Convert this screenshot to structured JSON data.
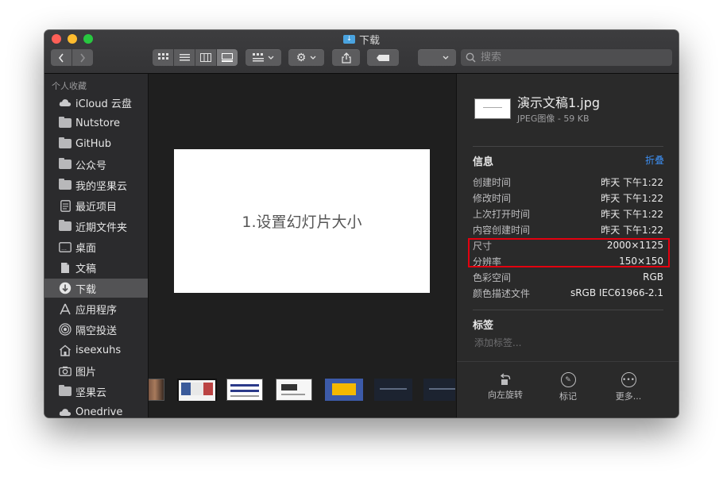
{
  "window": {
    "title": "下载"
  },
  "toolbar": {
    "search_placeholder": "搜索"
  },
  "sidebar": {
    "header": "个人收藏",
    "items": [
      {
        "label": "iCloud 云盘",
        "icon": "cloud-icon"
      },
      {
        "label": "Nutstore",
        "icon": "folder-icon"
      },
      {
        "label": "GitHub",
        "icon": "folder-icon"
      },
      {
        "label": "公众号",
        "icon": "folder-icon"
      },
      {
        "label": "我的坚果云",
        "icon": "folder-icon"
      },
      {
        "label": "最近项目",
        "icon": "recents-icon"
      },
      {
        "label": "近期文件夹",
        "icon": "folder-icon"
      },
      {
        "label": "桌面",
        "icon": "desktop-icon"
      },
      {
        "label": "文稿",
        "icon": "document-icon"
      },
      {
        "label": "下载",
        "icon": "download-icon",
        "selected": true
      },
      {
        "label": "应用程序",
        "icon": "applications-icon"
      },
      {
        "label": "隔空投送",
        "icon": "airdrop-icon"
      },
      {
        "label": "iseexuhs",
        "icon": "home-icon"
      },
      {
        "label": "图片",
        "icon": "camera-icon"
      },
      {
        "label": "坚果云",
        "icon": "folder-icon"
      },
      {
        "label": "Onedrive",
        "icon": "cloud-icon"
      }
    ]
  },
  "preview": {
    "slide_text": "1.设置幻灯片大小"
  },
  "info_panel": {
    "file_name": "演示文稿1.jpg",
    "file_meta": "JPEG图像 - 59 KB",
    "info_title": "信息",
    "fold_label": "折叠",
    "rows": [
      {
        "key": "创建时间",
        "value": "昨天 下午1:22"
      },
      {
        "key": "修改时间",
        "value": "昨天 下午1:22"
      },
      {
        "key": "上次打开时间",
        "value": "昨天 下午1:22"
      },
      {
        "key": "内容创建时间",
        "value": "昨天 下午1:22"
      },
      {
        "key": "尺寸",
        "value": "2000×1125"
      },
      {
        "key": "分辨率",
        "value": "150×150"
      },
      {
        "key": "色彩空间",
        "value": "RGB"
      },
      {
        "key": "颜色描述文件",
        "value": "sRGB IEC61966-2.1"
      }
    ],
    "tags_title": "标签",
    "tags_placeholder": "添加标签...",
    "actions": [
      {
        "label": "向左旋转",
        "icon": "rotate-left-icon"
      },
      {
        "label": "标记",
        "icon": "markup-icon"
      },
      {
        "label": "更多...",
        "icon": "more-icon"
      }
    ]
  },
  "colors": {
    "highlight_border": "#e3000f",
    "accent_link": "#3d8ff2",
    "selected_sidebar": "#535355"
  }
}
